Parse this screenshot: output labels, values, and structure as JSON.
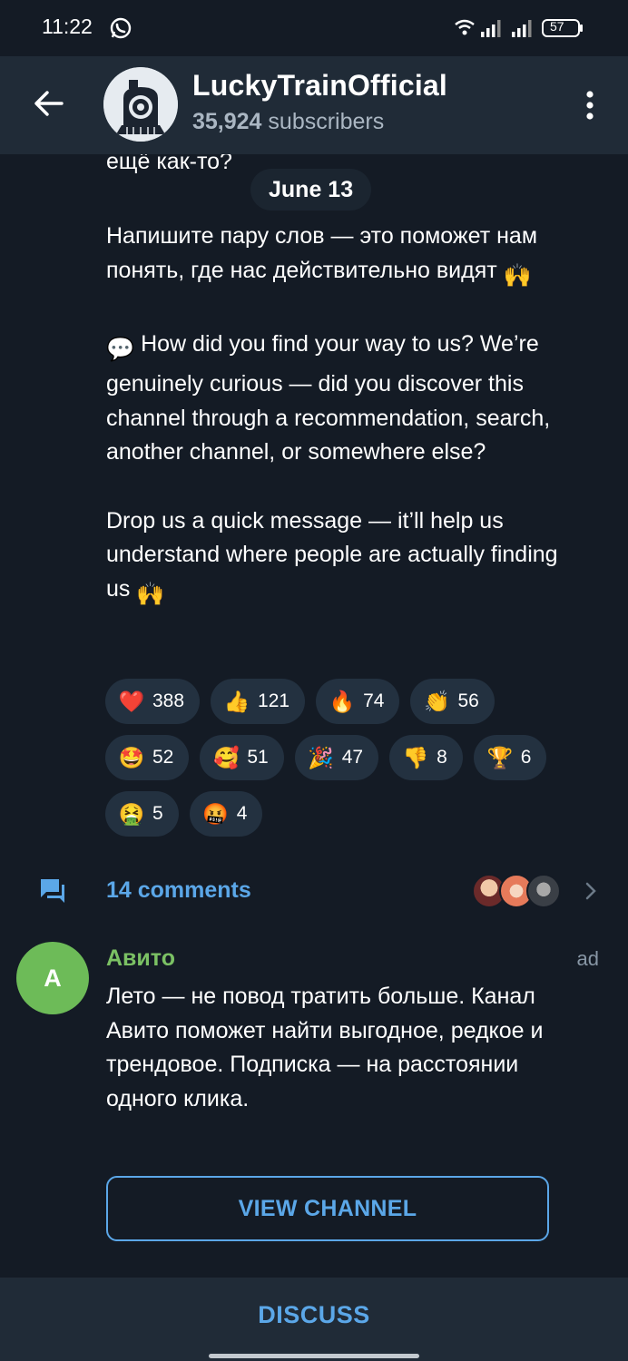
{
  "status_bar": {
    "time": "11:22",
    "battery": "57"
  },
  "header": {
    "channel_name": "LuckyTrainOfficial",
    "subscribers_count": "35,924",
    "subscribers_label": "subscribers"
  },
  "chat": {
    "partial_line": "ещё как-то?",
    "date_pill": "June 13",
    "message_ru": "Напишите пару слов — это поможет нам понять, где нас действительно видят",
    "message_en_1": "How did you find your way to us? We’re genuinely curious — did you discover this channel through a recommendation, search, another channel, or somewhere else?",
    "message_en_2": "Drop us a quick message — it’ll help us understand where people are actually finding us",
    "reactions": [
      {
        "emoji": "❤️",
        "count": "388",
        "icon": "heart-icon"
      },
      {
        "emoji": "👍",
        "count": "121",
        "icon": "thumbs-up-icon"
      },
      {
        "emoji": "🔥",
        "count": "74",
        "icon": "fire-icon"
      },
      {
        "emoji": "👏",
        "count": "56",
        "icon": "clap-icon"
      },
      {
        "emoji": "🤩",
        "count": "52",
        "icon": "star-struck-icon"
      },
      {
        "emoji": "🥰",
        "count": "51",
        "icon": "smiling-hearts-icon"
      },
      {
        "emoji": "🎉",
        "count": "47",
        "icon": "party-popper-icon"
      },
      {
        "emoji": "👎",
        "count": "8",
        "icon": "thumbs-down-icon"
      },
      {
        "emoji": "🏆",
        "count": "6",
        "icon": "trophy-icon"
      },
      {
        "emoji": "🤮",
        "count": "5",
        "icon": "vomiting-face-icon"
      },
      {
        "emoji": "🤬",
        "count": "4",
        "icon": "cursing-face-icon"
      }
    ],
    "comments_label": "14 comments"
  },
  "ad": {
    "avatar_letter": "A",
    "name": "Авито",
    "tag": "ad",
    "text": "Лето — не повод тратить больше. Канал Авито поможет найти выгодное, редкое и трендовое. Подписка — на расстоянии одного клика.",
    "button_label": "VIEW CHANNEL"
  },
  "bottom": {
    "discuss_label": "DISCUSS"
  },
  "colors": {
    "background": "#141b25",
    "header": "#202b37",
    "accent": "#5ba7e8",
    "ad_green": "#6dbb58",
    "reaction_chip": "#233140"
  }
}
